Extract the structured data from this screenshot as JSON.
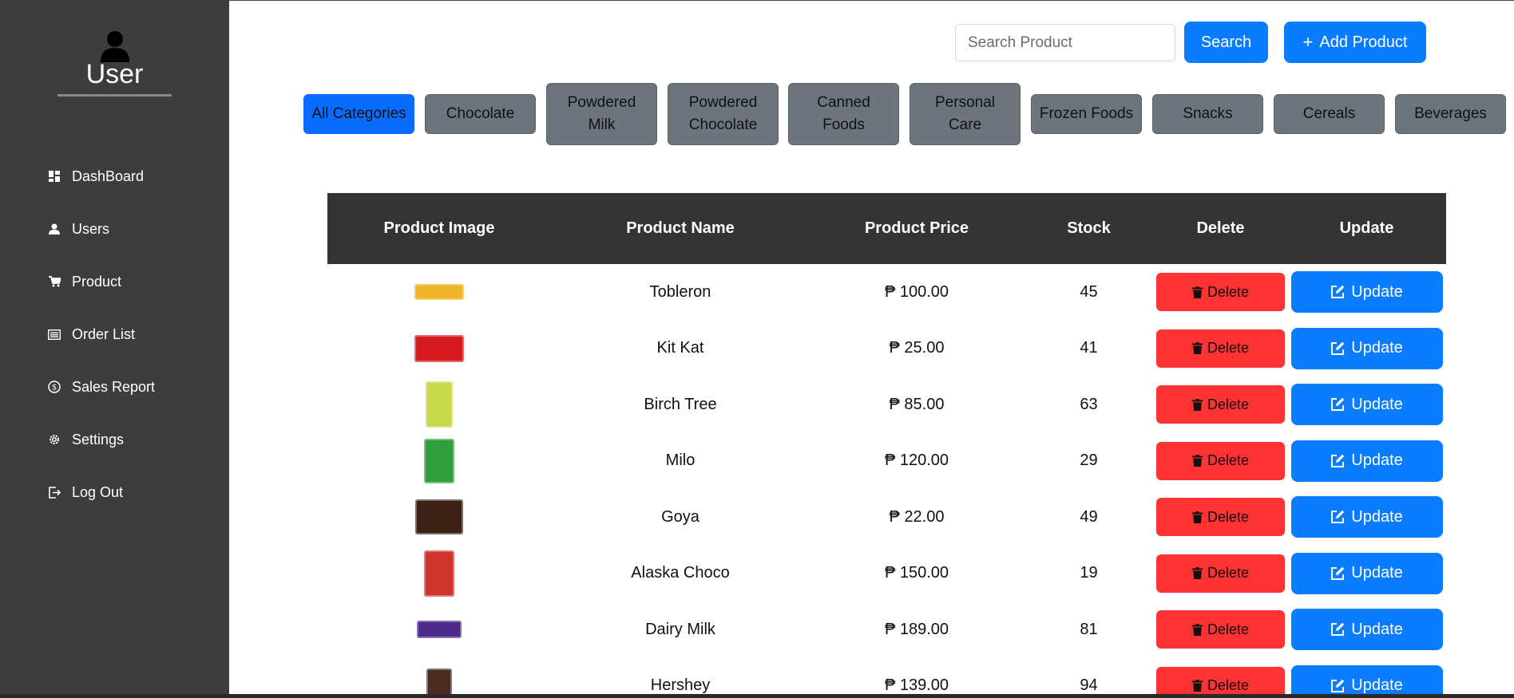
{
  "sidebar": {
    "user_label": "User",
    "items": [
      {
        "label": "DashBoard",
        "icon": "dashboard-icon"
      },
      {
        "label": "Users",
        "icon": "user-icon"
      },
      {
        "label": "Product",
        "icon": "cart-icon"
      },
      {
        "label": "Order List",
        "icon": "list-icon"
      },
      {
        "label": "Sales Report",
        "icon": "dollar-icon"
      },
      {
        "label": "Settings",
        "icon": "gear-icon"
      },
      {
        "label": "Log Out",
        "icon": "logout-icon"
      }
    ]
  },
  "toolbar": {
    "search_placeholder": "Search Product",
    "search_value": "",
    "search_label": "Search",
    "add_label": "Add Product",
    "add_icon": "plus-icon"
  },
  "categories": [
    {
      "label": "All Categories",
      "active": true
    },
    {
      "label": "Chocolate"
    },
    {
      "label": "Powdered\nMilk"
    },
    {
      "label": "Powdered\nChocolate"
    },
    {
      "label": "Canned\nFoods"
    },
    {
      "label": "Personal\nCare"
    },
    {
      "label": "Frozen Foods"
    },
    {
      "label": "Snacks"
    },
    {
      "label": "Cereals"
    },
    {
      "label": "Beverages"
    }
  ],
  "table": {
    "headers": [
      "Product Image",
      "Product Name",
      "Product Price",
      "Stock",
      "Delete",
      "Update"
    ],
    "delete_label": "Delete",
    "update_label": "Update",
    "rows": [
      {
        "name": "Tobleron",
        "price": "₱ 100.00",
        "stock": "45",
        "img_color": "#f0b429"
      },
      {
        "name": "Kit Kat",
        "price": "₱ 25.00",
        "stock": "41",
        "img_color": "#d71920"
      },
      {
        "name": "Birch Tree",
        "price": "₱ 85.00",
        "stock": "63",
        "img_color": "#c7d94a"
      },
      {
        "name": "Milo",
        "price": "₱ 120.00",
        "stock": "29",
        "img_color": "#2e9e3e"
      },
      {
        "name": "Goya",
        "price": "₱ 22.00",
        "stock": "49",
        "img_color": "#3b2116"
      },
      {
        "name": "Alaska Choco",
        "price": "₱ 150.00",
        "stock": "19",
        "img_color": "#d0342c"
      },
      {
        "name": "Dairy Milk",
        "price": "₱ 189.00",
        "stock": "81",
        "img_color": "#4b2a8c"
      },
      {
        "name": "Hershey",
        "price": "₱ 139.00",
        "stock": "94",
        "img_color": "#4a2c22"
      }
    ]
  },
  "colors": {
    "sidebar_bg": "#3d3d3d",
    "accent": "#0a7cff",
    "danger": "#ff3333",
    "category": "#6c757d"
  }
}
